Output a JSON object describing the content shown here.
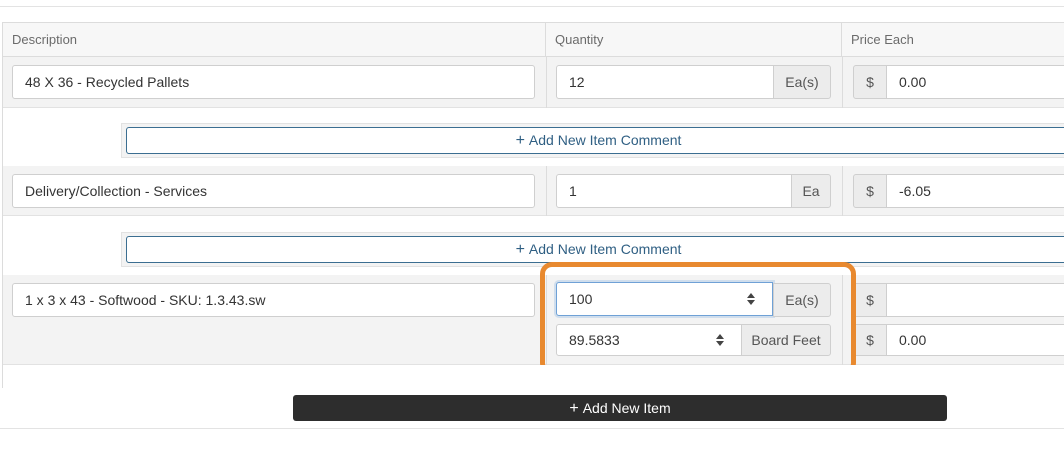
{
  "table": {
    "headers": {
      "description": "Description",
      "quantity": "Quantity",
      "price_each": "Price Each"
    },
    "rows": [
      {
        "description": "48 X 36 - Recycled Pallets",
        "quantity": "12",
        "unit": "Ea(s)",
        "currency": "$",
        "price": "0.00"
      },
      {
        "description": "Delivery/Collection - Services",
        "quantity": "1",
        "unit": "Ea",
        "currency": "$",
        "price": "-6.05"
      },
      {
        "description": "1 x 3 x 43 - Softwood - SKU: 1.3.43.sw",
        "quantity": "100",
        "unit": "Ea(s)",
        "currency": "$",
        "price": "",
        "secondary_quantity": "89.5833",
        "secondary_unit": "Board Feet",
        "secondary_currency": "$",
        "secondary_price": "0.00"
      }
    ],
    "comment_button_label": "Add New Item Comment",
    "comment_plus": "+"
  },
  "actions": {
    "add_item_label": "Add New Item",
    "add_item_plus": "+"
  },
  "colors": {
    "highlight": "#e8892f",
    "comment_button": "#2f5f83",
    "add_item_bg": "#2d2d2d"
  },
  "icons": {
    "plus": "plus-icon",
    "spinner": "spinner-arrows-icon"
  }
}
